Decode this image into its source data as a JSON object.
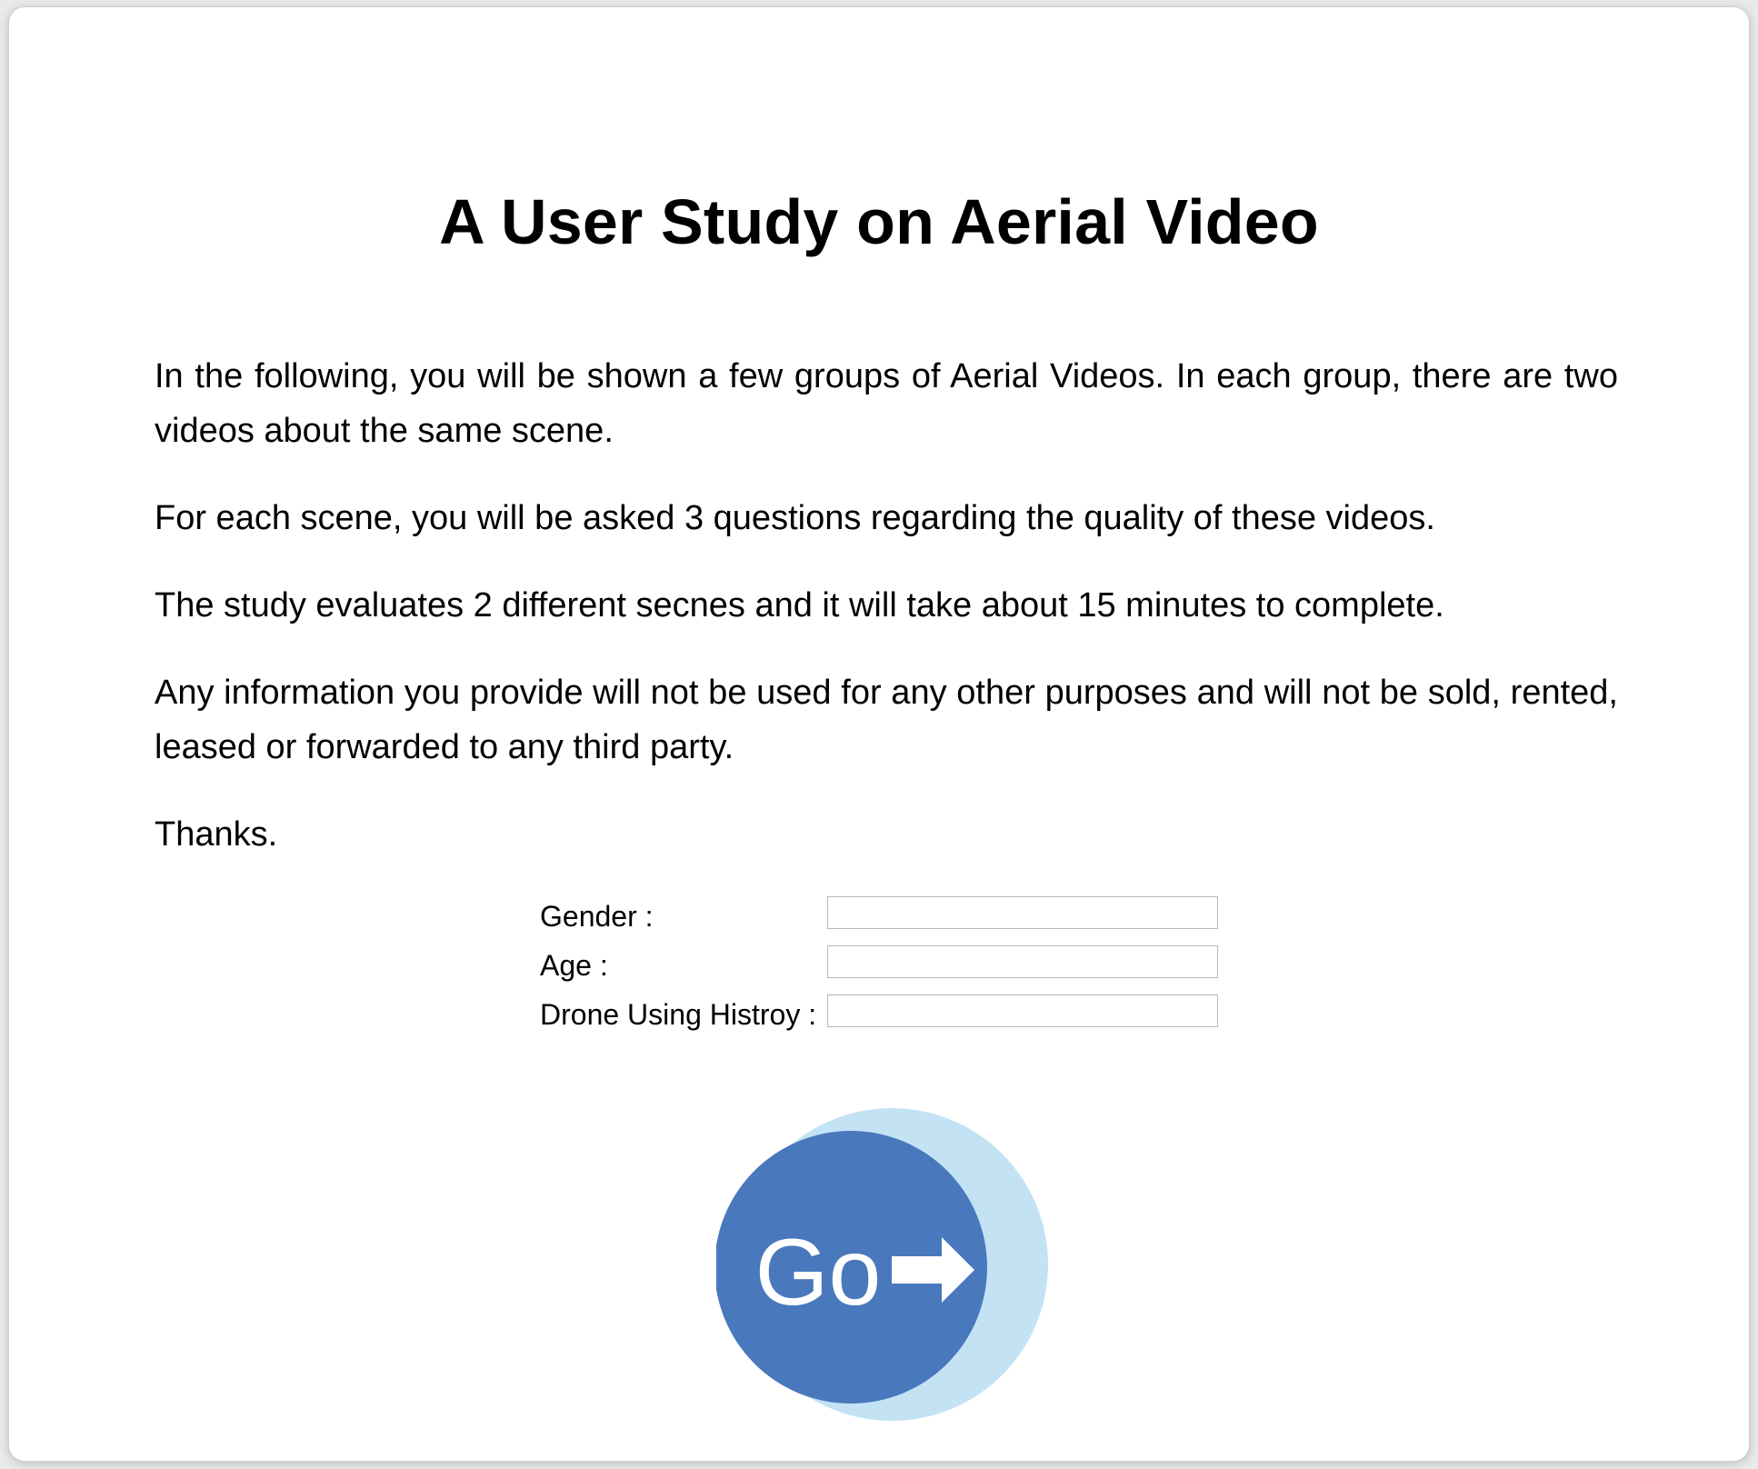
{
  "page": {
    "title": "A User Study on Aerial Video"
  },
  "intro": {
    "paragraphs": [
      "In the following, you will be shown a few groups of Aerial Videos. In each group, there are two videos about the same scene.",
      "For each scene, you will be asked 3 questions regarding the quality of these videos.",
      "The study evaluates 2 different secnes and it will take about 15 minutes to complete.",
      "Any information you provide will not be used for any other purposes and will not be sold, rented, leased or forwarded to any third party.",
      "Thanks."
    ]
  },
  "form": {
    "fields": [
      {
        "label": "Gender :",
        "value": ""
      },
      {
        "label": "Age :",
        "value": ""
      },
      {
        "label": "Drone Using Histroy :",
        "value": ""
      }
    ]
  },
  "go_button": {
    "label": "Go",
    "icon": "arrow-right-icon",
    "colors": {
      "circle": "#4a78bd",
      "halo": "#c3e3f4",
      "text": "#ffffff"
    }
  }
}
